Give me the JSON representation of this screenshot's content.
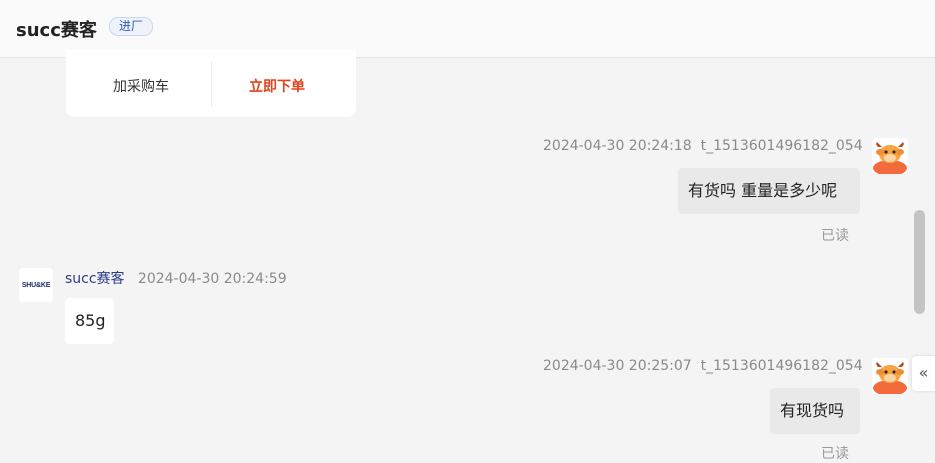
{
  "header": {
    "shop_name": "succ赛客",
    "shop_badge": "进厂"
  },
  "product_card": {
    "add_to_cart_label": "加采购车",
    "order_now_label": "立即下单"
  },
  "messages": [
    {
      "side": "right",
      "timestamp": "2024-04-30 20:24:18",
      "sender": "t_1513601496182_054",
      "text": "有货吗 重量是多少呢",
      "status": "已读",
      "avatar": "cow-avatar-icon"
    },
    {
      "side": "left",
      "sender": "succ赛客",
      "timestamp": "2024-04-30 20:24:59",
      "text": "85g",
      "avatar_text": "SHU&KE"
    },
    {
      "side": "right",
      "timestamp": "2024-04-30 20:25:07",
      "sender": "t_1513601496182_054",
      "text": "有现货吗",
      "status": "已读",
      "avatar": "cow-avatar-icon"
    }
  ],
  "sidebar_toggle": {
    "label": "«"
  },
  "colors": {
    "accent_order": "#e2421b",
    "bubble_right": "#e9e9e9",
    "bubble_left": "#ffffff",
    "background": "#f4f4f4"
  }
}
